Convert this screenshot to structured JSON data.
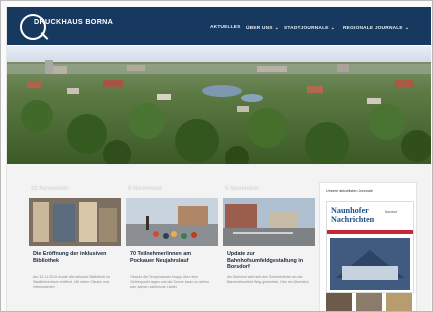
{
  "site": {
    "logo_text": "DRUCKHAUS BORNA"
  },
  "nav": [
    {
      "label": "AKTUELLES",
      "has_dropdown": false
    },
    {
      "label": "ÜBER UNS",
      "has_dropdown": true
    },
    {
      "label": "STADTJOURNALE",
      "has_dropdown": true
    },
    {
      "label": "REGIONALE JOURNALE",
      "has_dropdown": true
    }
  ],
  "articles": [
    {
      "date": "22 November",
      "title": "Die Eröffnung der inklusiven Bibliothek",
      "excerpt": "Am 15.11.2019 wurde die inklusive Bibliothek im Stadtteilzentrum eröffnet. Mit vielen Gästen und Interessierten"
    },
    {
      "date": "8 November",
      "title": "70 Teilnehmer/innen am Pockauer Neujahrslauf",
      "excerpt": "Obwohl die Temperaturen knapp über dem Gefrierpunkt lagen und die Sonne kaum zu sehen war, kamen zahlreiche Läufer"
    },
    {
      "date": "5 November",
      "title": "Update zur Bahnhofsumfeldgestaltung in Borsdorf",
      "excerpt": "Am Bahnhof wird seit den Sommerferien an der Bahnhofsumfeld Weg gearbeitet. Hier ein Überblick"
    }
  ],
  "sidebar": {
    "heading": "Unsere aktuellsten Journale",
    "paper_title": "Naunhofer Nachrichten",
    "paper_badge": "Naunhof"
  },
  "colors": {
    "header": "#17395f",
    "accent_red": "#c7283a",
    "title_blue": "#1e4f86"
  }
}
